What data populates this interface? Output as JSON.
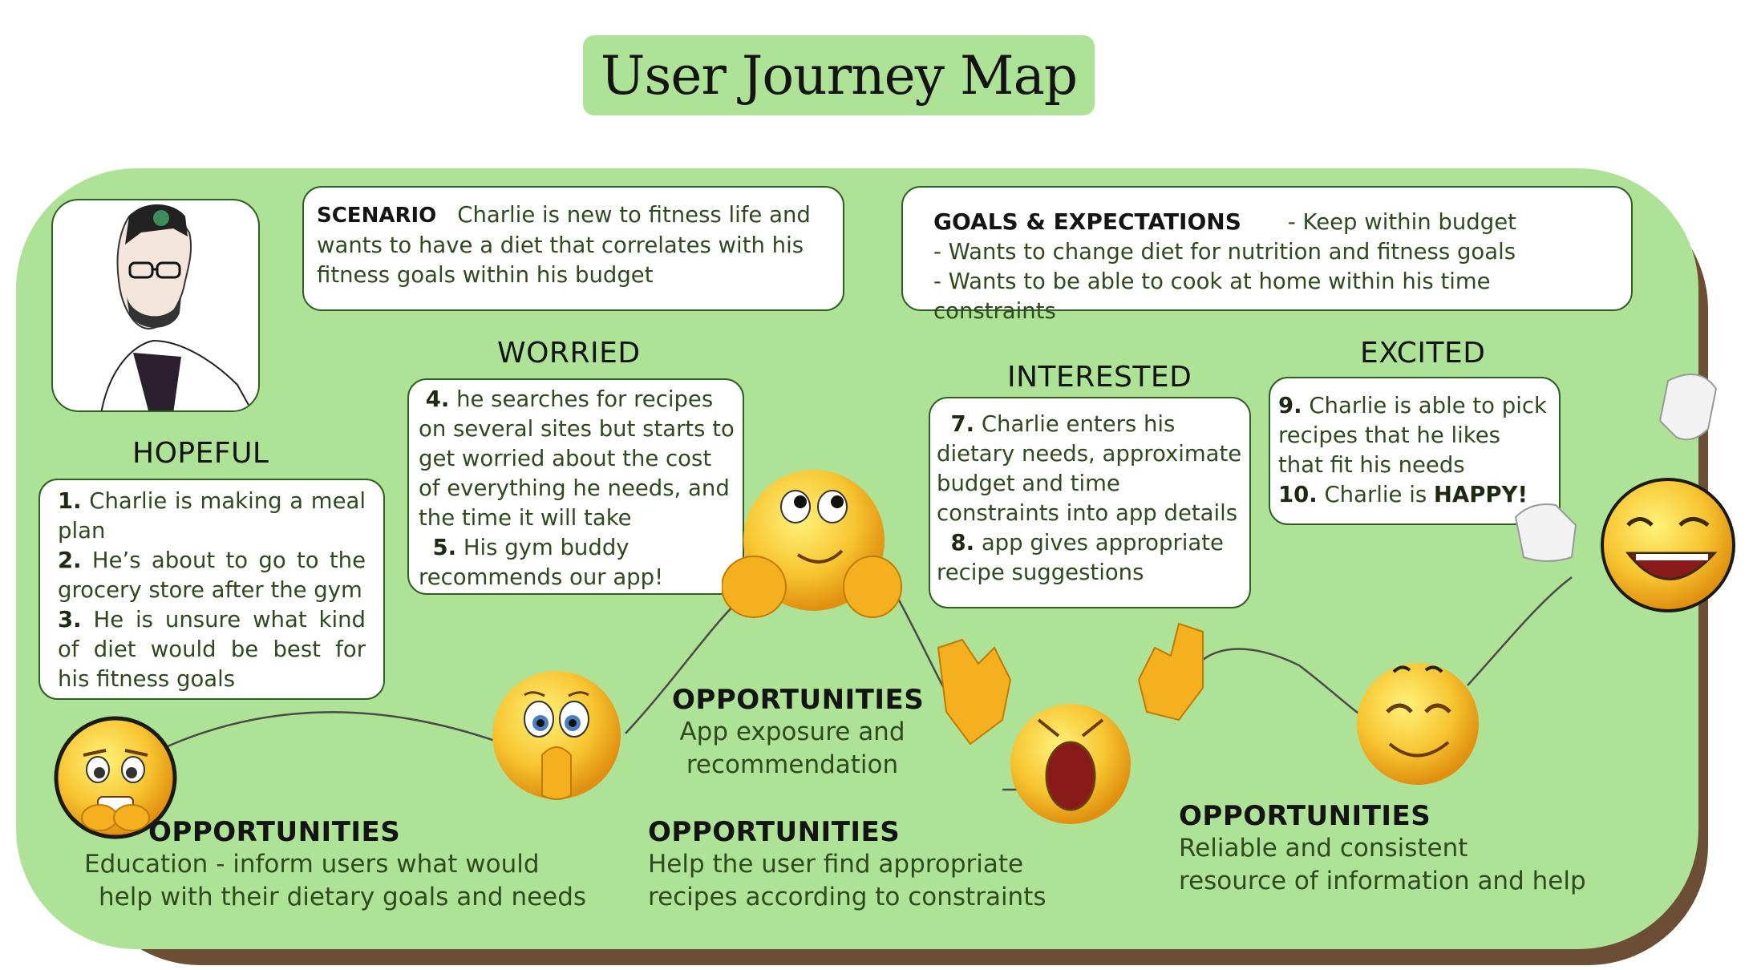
{
  "title": "User Journey Map",
  "persona": {
    "name": "Charlie",
    "avatar_icon": "persona-sketch-portrait"
  },
  "scenario": {
    "label": "SCENARIO",
    "text": "Charlie is new to fitness life and wants to have a diet that correlates with his fitness goals within his budget"
  },
  "goals": {
    "label": "GOALS & EXPECTATIONS",
    "items": [
      "- Keep within budget",
      "- Wants to change diet for nutrition and fitness goals",
      "- Wants to be able to cook at home within his time constraints"
    ]
  },
  "stages": [
    {
      "emotion": "HOPEFUL",
      "steps": [
        {
          "num": "1.",
          "text": "Charlie is making a meal plan"
        },
        {
          "num": "2.",
          "text": "He’s about to go to the grocery store after the gym"
        },
        {
          "num": "3.",
          "text": "He is unsure what kind of diet would be best for his fitness goals"
        }
      ]
    },
    {
      "emotion": "WORRIED",
      "steps": [
        {
          "num": "4.",
          "text": "he searches for recipes on several sites but starts to get worried about the cost of everything he needs, and the time it will take"
        },
        {
          "num": "5.",
          "text": "His gym buddy recommends our app!"
        }
      ]
    },
    {
      "emotion": "INTERESTED",
      "steps": [
        {
          "num": "7.",
          "text": "Charlie enters his dietary needs, approximate budget and time constraints into app details"
        },
        {
          "num": "8.",
          "text": "app gives appropriate recipe suggestions"
        }
      ]
    },
    {
      "emotion": "EXCITED",
      "steps": [
        {
          "num": "9.",
          "text": "Charlie is able to pick recipes that he likes that fit his needs"
        },
        {
          "num": "10.",
          "text": "Charlie is ",
          "emphasis": "HAPPY!"
        }
      ]
    }
  ],
  "opportunities": [
    {
      "heading": "OPPORTUNITIES",
      "text_lines": [
        "Education - inform users what would",
        "help with their dietary goals and needs"
      ]
    },
    {
      "heading": "OPPORTUNITIES",
      "text_lines": [
        "App exposure and",
        "recommendation"
      ]
    },
    {
      "heading": "OPPORTUNITIES",
      "text_lines": [
        "Help the user find appropriate",
        "recipes according to constraints"
      ]
    },
    {
      "heading": "OPPORTUNITIES",
      "text_lines": [
        "Reliable and consistent",
        "resource of information and help"
      ]
    }
  ],
  "emotion_curve": {
    "points": [
      "anxious",
      "surprised",
      "thinking",
      "crying",
      "content",
      "laughing"
    ],
    "icons": [
      "anxious-emoji-icon",
      "surprised-emoji-icon",
      "thinking-emoji-icon",
      "crying-emoji-icon",
      "content-emoji-icon",
      "laughing-emoji-icon"
    ]
  },
  "colors": {
    "board": "#aee296",
    "board_shadow": "#6b4e35",
    "card_border": "#2f5f22",
    "text": "#2f4a1f"
  }
}
